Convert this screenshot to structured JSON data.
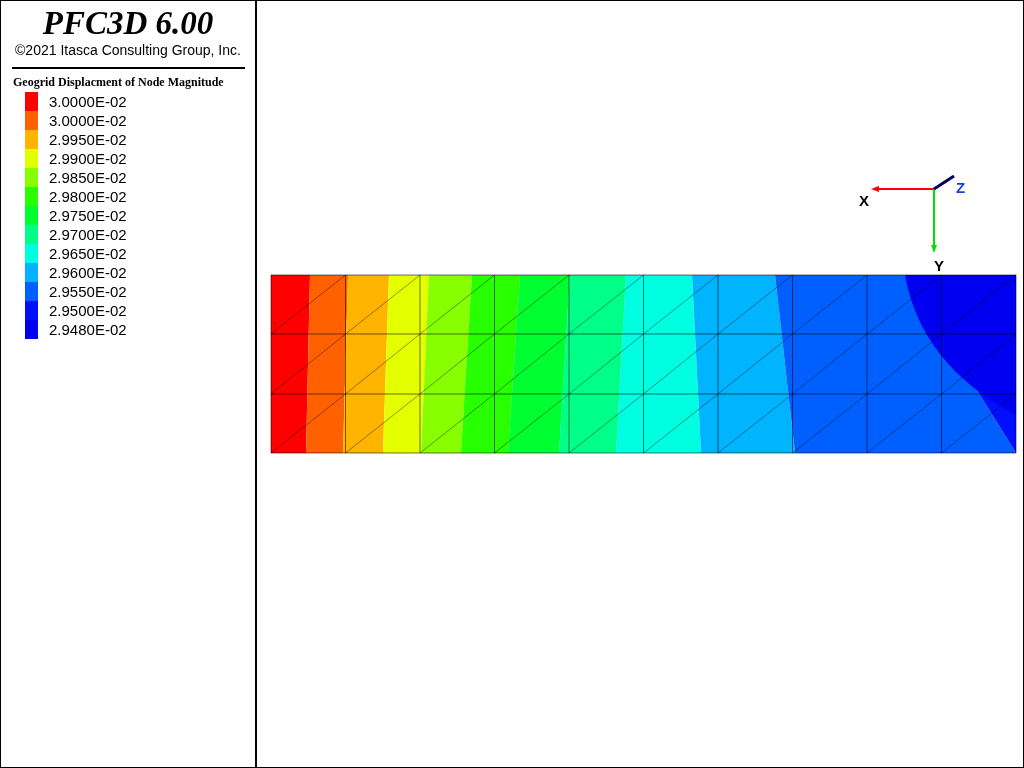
{
  "header": {
    "title": "PFC3D 6.00",
    "copyright": "©2021 Itasca Consulting Group, Inc."
  },
  "legend": {
    "title": "Geogrid Displacment of Node Magnitude",
    "items": [
      {
        "label": "3.0000E-02",
        "color": "#ff0000"
      },
      {
        "label": "3.0000E-02",
        "color": "#ff6000"
      },
      {
        "label": "2.9950E-02",
        "color": "#ffb400"
      },
      {
        "label": "2.9900E-02",
        "color": "#e4ff00"
      },
      {
        "label": "2.9850E-02",
        "color": "#88ff00"
      },
      {
        "label": "2.9800E-02",
        "color": "#28ff00"
      },
      {
        "label": "2.9750E-02",
        "color": "#00ff30"
      },
      {
        "label": "2.9700E-02",
        "color": "#00ff88"
      },
      {
        "label": "2.9650E-02",
        "color": "#00ffe0"
      },
      {
        "label": "2.9600E-02",
        "color": "#00b4ff"
      },
      {
        "label": "2.9550E-02",
        "color": "#0060ff"
      },
      {
        "label": "2.9500E-02",
        "color": "#0010ff"
      },
      {
        "label": "2.9480E-02",
        "color": "#0000f0"
      }
    ]
  },
  "axes": {
    "x": "X",
    "y": "Y",
    "z": "Z"
  }
}
